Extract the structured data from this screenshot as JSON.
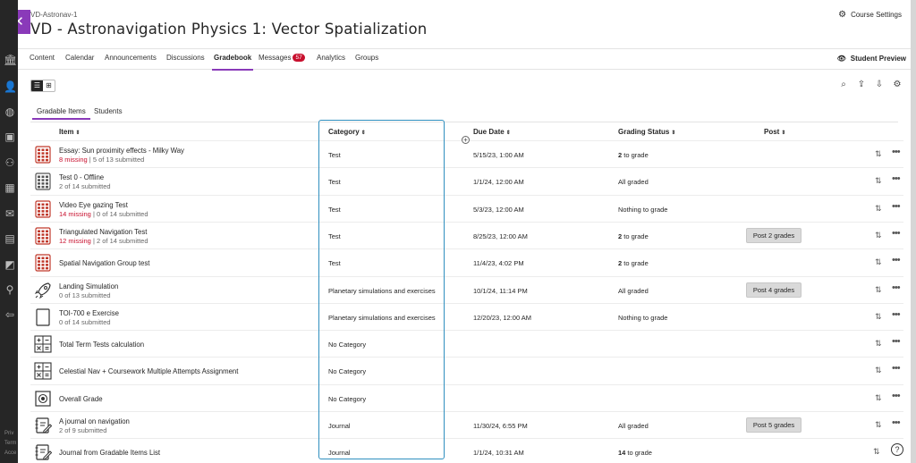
{
  "rail": {
    "footer_lines": [
      "Priv",
      "Term",
      "Acce"
    ]
  },
  "header": {
    "course_id": "VD-Astronav-1",
    "course_title": "VD - Astronavigation Physics 1: Vector Spatialization",
    "course_settings": "Course Settings",
    "close_icon": "close-icon"
  },
  "nav": {
    "tabs": [
      {
        "label": "Content"
      },
      {
        "label": "Calendar"
      },
      {
        "label": "Announcements"
      },
      {
        "label": "Discussions"
      },
      {
        "label": "Gradebook"
      },
      {
        "label": "Messages",
        "badge": "57"
      },
      {
        "label": "Analytics"
      },
      {
        "label": "Groups"
      }
    ],
    "student_preview": "Student Preview"
  },
  "subtabs": {
    "gradable_items": "Gradable Items",
    "students": "Students"
  },
  "columns": {
    "item": "Item",
    "category": "Category",
    "due_date": "Due Date",
    "grading_status": "Grading Status",
    "post": "Post"
  },
  "rows": [
    {
      "icon": "test-icon",
      "accent": "#c0392b",
      "name": "Essay: Sun proximity effects - Milky Way",
      "missing": "8 missing",
      "submitted": "5 of 13 submitted",
      "category": "Test",
      "due": "5/15/23, 1:00 AM",
      "grade_count": "2",
      "grade_text": " to grade",
      "post": ""
    },
    {
      "icon": "test-icon",
      "accent": "#555555",
      "name": "Test 0 - Offline",
      "missing": "",
      "submitted": "2 of 14 submitted",
      "category": "Test",
      "due": "1/1/24, 12:00 AM",
      "grade_count": "",
      "grade_text": "All graded",
      "post": ""
    },
    {
      "icon": "test-icon",
      "accent": "#c0392b",
      "name": "Video Eye gazing Test",
      "missing": "14 missing",
      "submitted": "0 of 14 submitted",
      "category": "Test",
      "due": "5/3/23, 12:00 AM",
      "grade_count": "",
      "grade_text": "Nothing to grade",
      "post": ""
    },
    {
      "icon": "test-icon",
      "accent": "#c0392b",
      "name": "Triangulated Navigation Test",
      "missing": "12 missing",
      "submitted": "2 of 14 submitted",
      "category": "Test",
      "due": "8/25/23, 12:00 AM",
      "grade_count": "2",
      "grade_text": " to grade",
      "post": "Post 2 grades"
    },
    {
      "icon": "test-icon",
      "accent": "#c0392b",
      "name": "Spatial Navigation Group test",
      "missing": "",
      "submitted": "",
      "category": "Test",
      "due": "11/4/23, 4:02 PM",
      "grade_count": "2",
      "grade_text": " to grade",
      "post": ""
    },
    {
      "icon": "rocket-icon",
      "accent": "#333333",
      "name": "Landing Simulation",
      "missing": "",
      "submitted": "0 of 13 submitted",
      "category": "Planetary simulations and exercises",
      "due": "10/1/24, 11:14 PM",
      "grade_count": "",
      "grade_text": "All graded",
      "post": "Post 4 grades"
    },
    {
      "icon": "document-icon",
      "accent": "#333333",
      "name": "TOI-700 e Exercise",
      "missing": "",
      "submitted": "0 of 14 submitted",
      "category": "Planetary simulations and exercises",
      "due": "12/20/23, 12:00 AM",
      "grade_count": "",
      "grade_text": "Nothing to grade",
      "post": ""
    },
    {
      "icon": "calculation-icon",
      "accent": "#333333",
      "name": "Total Term Tests calculation",
      "missing": "",
      "submitted": "",
      "category": "No Category",
      "due": "",
      "grade_count": "",
      "grade_text": "",
      "post": ""
    },
    {
      "icon": "calculation-icon",
      "accent": "#333333",
      "name": "Celestial Nav + Coursework Multiple Attempts Assignment",
      "missing": "",
      "submitted": "",
      "category": "No Category",
      "due": "",
      "grade_count": "",
      "grade_text": "",
      "post": ""
    },
    {
      "icon": "overall-grade-icon",
      "accent": "#333333",
      "name": "Overall Grade",
      "missing": "",
      "submitted": "",
      "category": "No Category",
      "due": "",
      "grade_count": "",
      "grade_text": "",
      "post": ""
    },
    {
      "icon": "journal-icon",
      "accent": "#333333",
      "name": "A journal on navigation",
      "missing": "",
      "submitted": "2 of 9 submitted",
      "category": "Journal",
      "due": "11/30/24, 6:55 PM",
      "grade_count": "",
      "grade_text": "All graded",
      "post": "Post 5 grades"
    },
    {
      "icon": "journal-icon",
      "accent": "#333333",
      "name": "Journal from Gradable Items List",
      "missing": "",
      "submitted": "",
      "category": "Journal",
      "due": "1/1/24, 10:31 AM",
      "grade_count": "14",
      "grade_text": " to grade",
      "post": ""
    }
  ]
}
